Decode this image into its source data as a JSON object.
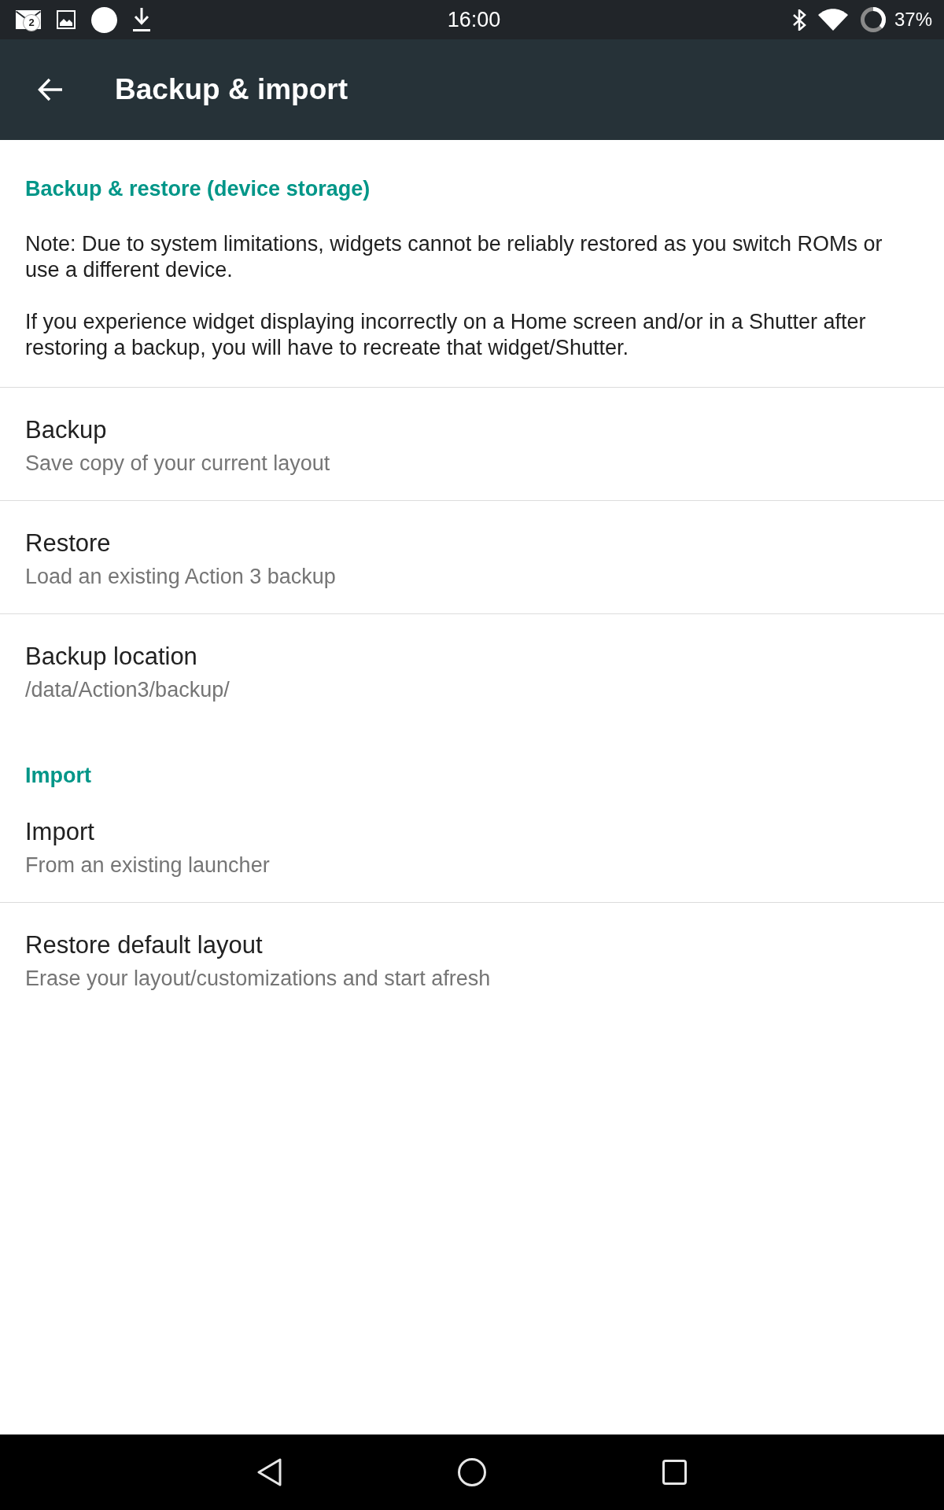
{
  "status_bar": {
    "mail_count": "2",
    "time": "16:00",
    "battery": "37%"
  },
  "app_bar": {
    "title": "Backup & import"
  },
  "sections": [
    {
      "header": "Backup & restore (device storage)",
      "items": [
        {
          "kind": "note",
          "paragraphs": [
            "Note: Due to system limitations, widgets cannot be reliably restored as you switch ROMs or use a different device.",
            "If you experience widget displaying incorrectly on a Home screen and/or in a Shutter after restoring a backup, you will have to recreate that widget/Shutter."
          ]
        },
        {
          "kind": "preference",
          "title": "Backup",
          "summary": "Save copy of your current layout"
        },
        {
          "kind": "preference",
          "title": "Restore",
          "summary": "Load an existing Action 3 backup"
        },
        {
          "kind": "preference",
          "title": "Backup location",
          "summary": "/data/Action3/backup/"
        }
      ]
    },
    {
      "header": "Import",
      "items": [
        {
          "kind": "preference",
          "title": "Import",
          "summary": "From an existing launcher"
        },
        {
          "kind": "preference",
          "title": "Restore default layout",
          "summary": "Erase your layout/customizations and start afresh"
        }
      ]
    }
  ]
}
